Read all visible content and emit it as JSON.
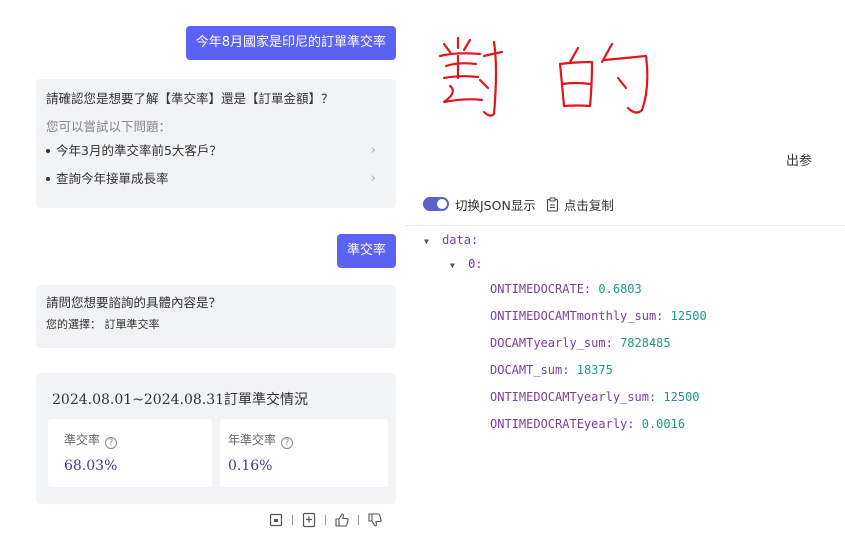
{
  "chat": {
    "user_msg_1": "今年8月國家是印尼的訂單準交率",
    "clarify_question": "請確認您是想要了解【準交率】還是【訂單金額】？",
    "suggestion_hint": "您可以嘗試以下問題：",
    "suggestions": [
      "今年3月的準交率前5大客戶？",
      "查詢今年接單成長率"
    ],
    "user_msg_2": "準交率",
    "followup_question": "請問您想要諮詢的具體內容是？",
    "your_choice": "您的選擇： 訂單準交率",
    "result_title": "2024.08.01~2024.08.31訂單準交情況",
    "metrics": [
      {
        "label": "準交率",
        "value": "68.03%"
      },
      {
        "label": "年準交率",
        "value": "0.16%"
      }
    ]
  },
  "annotation": {
    "handwriting": "對的",
    "color": "#e0161c"
  },
  "right_panel": {
    "params_label": "出参",
    "toggle_label": "切换JSON显示",
    "copy_label": "点击复制",
    "json": {
      "root_key": "data:",
      "index_key": "0:",
      "fields": [
        {
          "key": "ONTIMEDOCRATE:",
          "value": "0.6803"
        },
        {
          "key": "ONTIMEDOCAMTmonthly_sum:",
          "value": "12500"
        },
        {
          "key": "DOCAMTyearly_sum:",
          "value": "7828485"
        },
        {
          "key": "DOCAMT_sum:",
          "value": "18375"
        },
        {
          "key": "ONTIMEDOCAMTyearly_sum:",
          "value": "12500"
        },
        {
          "key": "ONTIMEDOCRATEyearly:",
          "value": "0.0016"
        }
      ]
    }
  },
  "colors": {
    "accent": "#5b63f5",
    "card_bg": "#f2f3f5",
    "json_key": "#7a3e9d",
    "json_value": "#1a9a8a"
  }
}
